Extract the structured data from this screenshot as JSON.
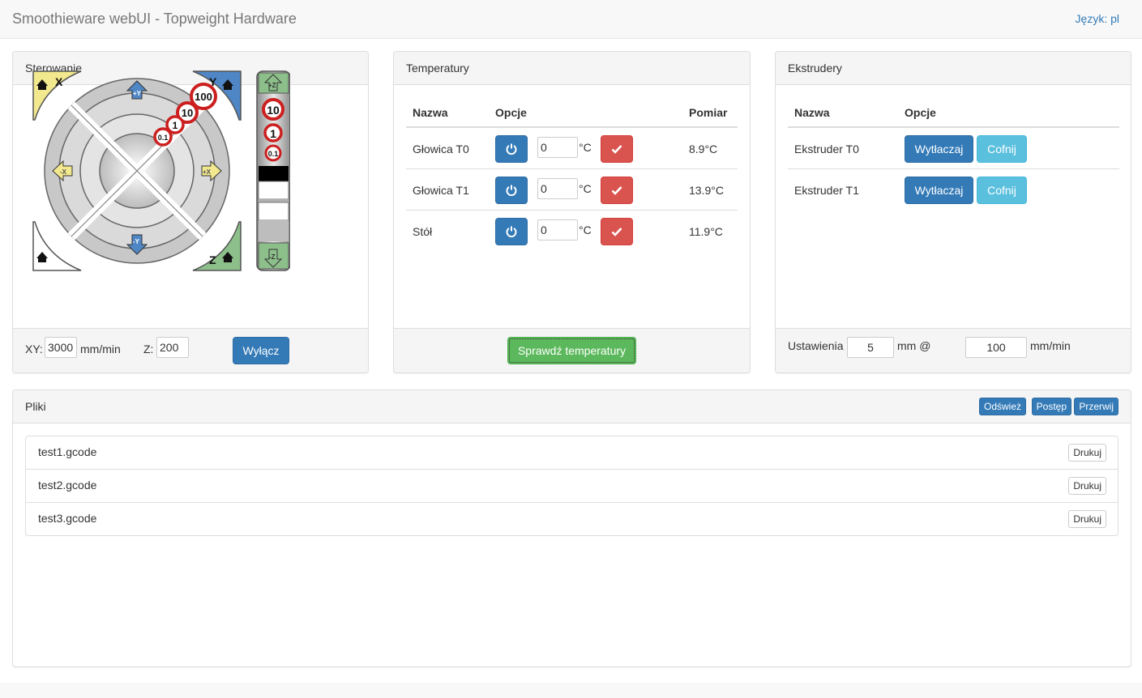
{
  "app": {
    "title": "Smoothieware webUI - Topweight Hardware",
    "language_link": "Język: pl"
  },
  "control": {
    "title": "Sterowanie",
    "jog": {
      "home_x": "X",
      "home_y": "Y",
      "home_z": "Z",
      "plus_y": "+Y",
      "minus_y": "-Y",
      "minus_x": "-X",
      "plus_x": "+X",
      "plus_z": "+Z",
      "minus_z": "-Z",
      "xy_steps": [
        "100",
        "10",
        "1",
        "0.1"
      ],
      "z_steps": [
        "10",
        "1",
        "0.1"
      ]
    },
    "xy_label": "XY:",
    "xy_value": "3000",
    "xy_unit": "mm/min",
    "z_label": "Z:",
    "z_value": "200",
    "off_button": "Wyłącz"
  },
  "temperatures": {
    "title": "Temperatury",
    "columns": {
      "name": "Nazwa",
      "options": "Opcje",
      "measure": "Pomiar"
    },
    "rows": [
      {
        "name": "Głowica T0",
        "value": "0",
        "unit": "°C",
        "reading": "8.9°C"
      },
      {
        "name": "Głowica T1",
        "value": "0",
        "unit": "°C",
        "reading": "13.9°C"
      },
      {
        "name": "Stół",
        "value": "0",
        "unit": "°C",
        "reading": "11.9°C"
      }
    ],
    "check_button": "Sprawdź temperatury"
  },
  "extruders": {
    "title": "Ekstrudery",
    "columns": {
      "name": "Nazwa",
      "options": "Opcje"
    },
    "rows": [
      {
        "name": "Ekstruder T0",
        "extrude": "Wytłaczaj",
        "retract": "Cofnij"
      },
      {
        "name": "Ekstruder T1",
        "extrude": "Wytłaczaj",
        "retract": "Cofnij"
      }
    ],
    "settings_label": "Ustawienia",
    "length_value": "5",
    "length_unit": "mm @",
    "speed_value": "100",
    "speed_unit": "mm/min"
  },
  "files": {
    "title": "Pliki",
    "refresh": "Odśwież",
    "progress": "Postęp",
    "abort": "Przerwij",
    "items": [
      {
        "name": "test1.gcode",
        "print": "Drukuj"
      },
      {
        "name": "test2.gcode",
        "print": "Drukuj"
      },
      {
        "name": "test3.gcode",
        "print": "Drukuj"
      }
    ]
  },
  "colors": {
    "primary": "#337ab7",
    "info": "#5bc0de",
    "danger": "#d9534f",
    "success": "#5cb85c",
    "jog_x": "#f2e88e",
    "jog_y": "#4f86c6",
    "jog_z": "#8dbf8b",
    "step_ring": "#cc1f1f"
  }
}
